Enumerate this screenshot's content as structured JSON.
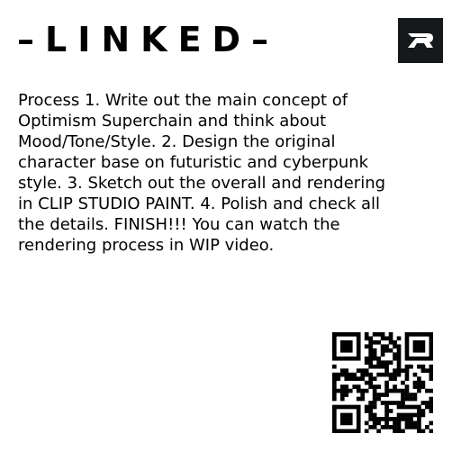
{
  "header": {
    "title": "–LINKED–",
    "logo_icon": "brand-logo-icon"
  },
  "content": {
    "description": "Process 1. Write out the main concept of Optimism Superchain and think about Mood/Tone/Style. 2. Design the original character base on futuristic and cyberpunk style. 3. Sketch out the overall and rendering in CLIP STUDIO PAINT. 4. Polish and check all the details. FINISH!!! You can watch the rendering process in WIP video."
  },
  "qr": {
    "icon": "qr-code-icon"
  },
  "colors": {
    "background": "#ffffff",
    "text": "#000000",
    "logo_background": "#16191b",
    "logo_mark": "#ffffff"
  }
}
